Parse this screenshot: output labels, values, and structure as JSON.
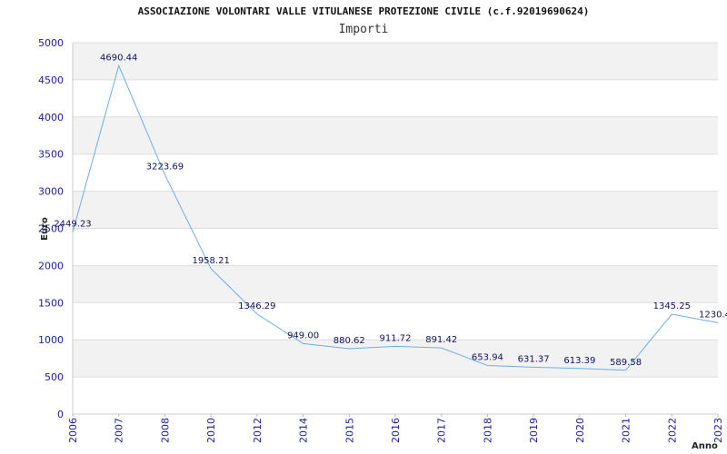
{
  "chart_data": {
    "type": "line",
    "title": "ASSOCIAZIONE VOLONTARI VALLE VITULANESE PROTEZIONE CIVILE (c.f.92019690624)",
    "subtitle": "Importi",
    "xlabel": "Anno",
    "ylabel": "Euro",
    "categories": [
      "2006",
      "2007",
      "2008",
      "2010",
      "2012",
      "2014",
      "2015",
      "2016",
      "2017",
      "2018",
      "2019",
      "2020",
      "2021",
      "2022",
      "2023"
    ],
    "values": [
      2449.23,
      4690.44,
      3223.69,
      1958.21,
      1346.29,
      949.0,
      880.62,
      911.72,
      891.42,
      653.94,
      631.37,
      613.39,
      589.58,
      1345.25,
      1230.4
    ],
    "data_labels": [
      "2449.23",
      "4690.44",
      "3223.69",
      "1958.21",
      "1346.29",
      "949.00",
      "880.62",
      "911.72",
      "891.42",
      "653.94",
      "631.37",
      "613.39",
      "589.58",
      "1345.25",
      "1230.4"
    ],
    "ylim": [
      0,
      5000
    ],
    "yticks": [
      "0",
      "500",
      "1000",
      "1500",
      "2000",
      "2500",
      "3000",
      "3500",
      "4000",
      "4500",
      "5000"
    ],
    "grid": true,
    "line_color": "#6aaee8",
    "band_color": "#f2f2f2",
    "tick_color": "#1a1aa6"
  }
}
